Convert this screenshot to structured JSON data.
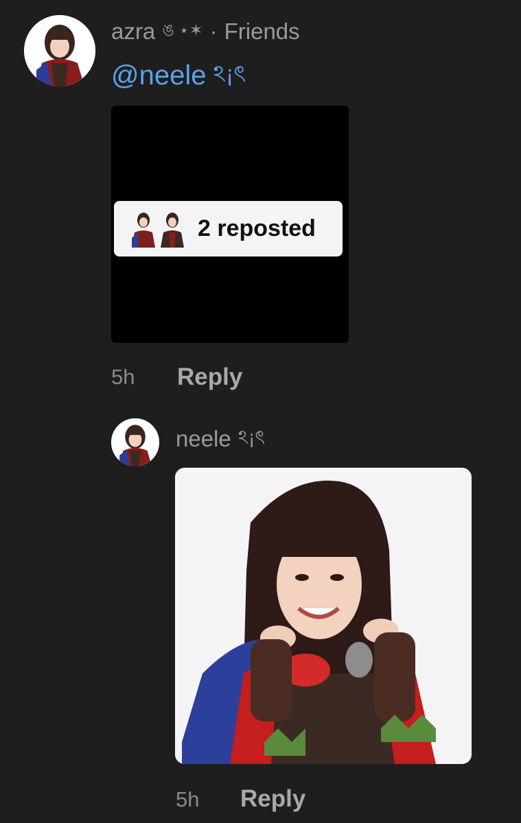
{
  "comments": [
    {
      "username": "azra",
      "name_deco": "ঙ ⋆✶",
      "separator": "·",
      "relation": "Friends",
      "mention": "@neele",
      "mention_deco": "ঽ¡ৎ",
      "media": {
        "pill_text": "2 reposted"
      },
      "time": "5h",
      "reply_label": "Reply"
    },
    {
      "username": "neele",
      "name_deco": "ঽ¡ৎ",
      "time": "5h",
      "reply_label": "Reply"
    }
  ],
  "colors": {
    "background": "#1e1e1f",
    "mention": "#5aa2f0",
    "meta_text": "#9a9a9c"
  },
  "icons": [
    "avatar-photo",
    "repost-avatar",
    "photo"
  ]
}
